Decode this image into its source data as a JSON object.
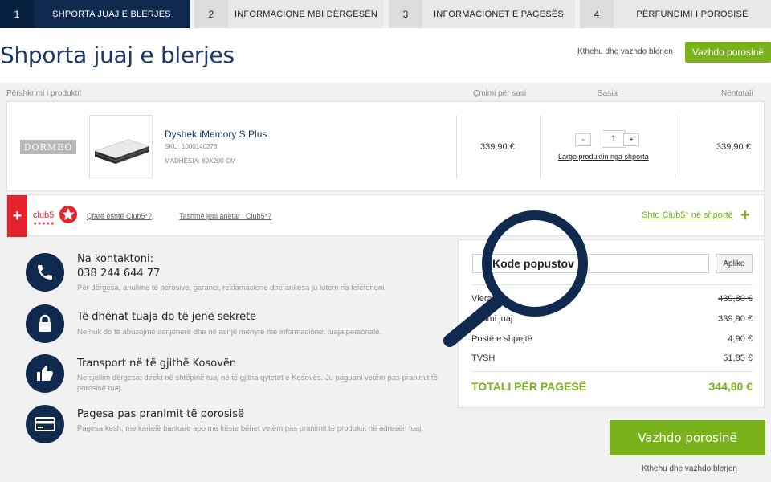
{
  "steps": [
    {
      "num": "1",
      "label": "SHPORTA JUAJ E BLERJES"
    },
    {
      "num": "2",
      "label": "INFORMACIONE MBI DËRGESËN"
    },
    {
      "num": "3",
      "label": "INFORMACIONET E PAGESËS"
    },
    {
      "num": "4",
      "label": "PËRFUNDIMI I POROSISË"
    }
  ],
  "page": {
    "title": "Shporta juaj e blerjes",
    "back_link": "Kthehu dhe vazhdo blerjen",
    "continue_button": "Vazhdo porosinë"
  },
  "columns": {
    "description": "Përshkrimi i produktit",
    "unit_price": "Çmimi për sasi",
    "quantity": "Sasia",
    "subtotal": "Nëntotali"
  },
  "product": {
    "brand": "DORMEO",
    "name": "Dyshek iMemory S Plus",
    "sku": "SKU: 1000140276",
    "size": "MADHËSIA: 80X200 CM",
    "unit_price": "339,90 €",
    "quantity": "1",
    "minus": "-",
    "plus": "+",
    "remove_link": "Largo produktin nga shporta",
    "subtotal": "339,90 €"
  },
  "club": {
    "logo_text": "club5",
    "question1": "Çfarë është Club5*?",
    "question2": "Tashmë jeni anëtar i Club5*?",
    "add_link": "Shto Club5* në shportë",
    "plus_icon": "+"
  },
  "info": [
    {
      "icon": "phone-icon",
      "title": "Na kontaktoni:",
      "phone": "038 244 644 77",
      "desc": "Për dërgesa, anulime të porosive, garanci, reklamacione dhe ankesa ju lutem na telefononi."
    },
    {
      "icon": "lock-icon",
      "title": "Të dhënat tuaja do të jenë sekrete",
      "desc": "Ne nuk do të abuzojmë asnjëherë dhe në asnjë mënyrë me informacionet tuaja personale."
    },
    {
      "icon": "thumbs-up-icon",
      "title": "Transport në të gjithë Kosovën",
      "desc": "Ne sjellim dërgesat direkt në shtëpinë tuaj në të gjitha qytetet e Kosovës. Ju paguani vetëm pas pranimit të porosisë tuaj."
    },
    {
      "icon": "credit-card-icon",
      "title": "Pagesa pas pranimit të porosisë",
      "desc": "Pagesa kesh, me kartelë bankare apo me këste bëhet vetëm pas pranimit të produktit në adresën tuaj."
    }
  ],
  "summary": {
    "coupon_value": "Kode popustov",
    "apply_button": "Apliko",
    "rows": [
      {
        "label": "Vlera",
        "value": "439,80 €"
      },
      {
        "label": "Çmimi juaj",
        "value": "339,90 €"
      },
      {
        "label": "Postë e shpejtë",
        "value": "4,90 €"
      },
      {
        "label": "TVSH",
        "value": "51,85 €"
      }
    ],
    "total_label": "TOTALI PËR PAGESË",
    "total_value": "344,80 €"
  },
  "bottom": {
    "continue_button": "Vazhdo porosinë",
    "back_link": "Kthehu dhe vazhdo blerjen"
  },
  "colors": {
    "navy": "#0f2a4e",
    "green": "#7ab21c",
    "red": "#e4232c"
  }
}
